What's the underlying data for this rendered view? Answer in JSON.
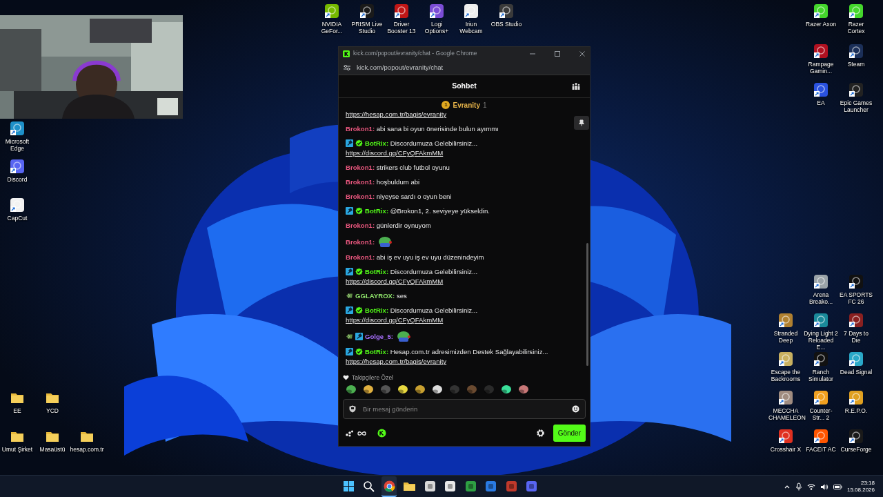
{
  "desktop_icons": [
    {
      "label": "Microsoft Edge",
      "kind": "app",
      "color": "#1e90c8"
    },
    {
      "label": "Discord",
      "kind": "app",
      "color": "#5865f2"
    },
    {
      "label": "CapCut",
      "kind": "app",
      "color": "#f2f2f2"
    },
    {
      "label": "NVIDIA GeFor...",
      "kind": "app",
      "color": "#76b900"
    },
    {
      "label": "PRISM Live Studio",
      "kind": "app",
      "color": "#1a1a1a"
    },
    {
      "label": "Driver Booster 13",
      "kind": "app",
      "color": "#c01616"
    },
    {
      "label": "Logi Options+",
      "kind": "app",
      "color": "#7b4dd6"
    },
    {
      "label": "Iriun Webcam",
      "kind": "app",
      "color": "#eeeeee"
    },
    {
      "label": "OBS Studio",
      "kind": "app",
      "color": "#3a3a3a"
    },
    {
      "label": "Razer Axon",
      "kind": "app",
      "color": "#44d62c"
    },
    {
      "label": "Razer Cortex",
      "kind": "app",
      "color": "#44d62c"
    },
    {
      "label": "Rampage Gamin...",
      "kind": "app",
      "color": "#b01020"
    },
    {
      "label": "Steam",
      "kind": "app",
      "color": "#1b2f58"
    },
    {
      "label": "EA",
      "kind": "app",
      "color": "#2a52e0"
    },
    {
      "label": "Epic Games Launcher",
      "kind": "app",
      "color": "#222222"
    },
    {
      "label": "Arena Breako...",
      "kind": "app",
      "color": "#9aa3a8"
    },
    {
      "label": "EA SPORTS FC 26",
      "kind": "app",
      "color": "#111111"
    },
    {
      "label": "Stranded Deep",
      "kind": "app",
      "color": "#b08030"
    },
    {
      "label": "Dying Light 2 Reloaded E...",
      "kind": "app",
      "color": "#1a8a9a"
    },
    {
      "label": "7 Days to Die",
      "kind": "app",
      "color": "#8a2020"
    },
    {
      "label": "Escape the Backrooms",
      "kind": "app",
      "color": "#c8b060"
    },
    {
      "label": "Ranch Simulator",
      "kind": "app",
      "color": "#111111"
    },
    {
      "label": "Dead Signal",
      "kind": "app",
      "color": "#2aa8c8"
    },
    {
      "label": "MECCHA CHAMELEON",
      "kind": "app",
      "color": "#a08c80"
    },
    {
      "label": "Counter-Str... 2",
      "kind": "app",
      "color": "#f0a020"
    },
    {
      "label": "R.E.P.O.",
      "kind": "app",
      "color": "#e0a020"
    },
    {
      "label": "Crosshair X",
      "kind": "app",
      "color": "#e03020"
    },
    {
      "label": "FACEIT AC",
      "kind": "app",
      "color": "#ff5500"
    },
    {
      "label": "CurseForge",
      "kind": "app",
      "color": "#1a1a1a"
    },
    {
      "label": "EE",
      "kind": "folder"
    },
    {
      "label": "YCD",
      "kind": "folder"
    },
    {
      "label": "Umut Şirket",
      "kind": "folder"
    },
    {
      "label": "Masaüstü",
      "kind": "folder"
    },
    {
      "label": "hesap.com.tr",
      "kind": "folder"
    }
  ],
  "chat_window": {
    "title": "kick.com/popout/evranity/chat - Google Chrome",
    "address": "kick.com/popout/evranity/chat",
    "header": "Sohbet",
    "pinned": {
      "rank": "1",
      "user": "Evranity",
      "count": "1"
    },
    "messages": [
      {
        "kind": "link",
        "link": "https://hesap.com.tr/bagis/evranity"
      },
      {
        "kind": "text",
        "user": "Brokon1:",
        "color": "#e9577e",
        "text": "abi sana bi oyun önerisinde bulun ayımmı"
      },
      {
        "kind": "text",
        "user": "BotRix:",
        "color": "#53fc18",
        "moderator": true,
        "verified": true,
        "text": "Discordumuza Gelebilirsiniz...",
        "link": "https://discord.gg/CFyQFAkmMM"
      },
      {
        "kind": "text",
        "user": "Brokon1:",
        "color": "#e9577e",
        "text": "strikers club futbol oyunu"
      },
      {
        "kind": "text",
        "user": "Brokon1:",
        "color": "#e9577e",
        "text": "hoşbuldum abi"
      },
      {
        "kind": "text",
        "user": "Brokon1:",
        "color": "#e9577e",
        "text": "niyeyse sardı o oyun beni"
      },
      {
        "kind": "text",
        "user": "BotRix:",
        "color": "#53fc18",
        "moderator": true,
        "verified": true,
        "text": "@Brokon1, 2. seviyeye yükseldin."
      },
      {
        "kind": "text",
        "user": "Brokon1:",
        "color": "#e9577e",
        "text": "günlerdir oynuyom"
      },
      {
        "kind": "emote",
        "user": "Brokon1:",
        "color": "#e9577e"
      },
      {
        "kind": "text",
        "user": "Brokon1:",
        "color": "#e9577e",
        "text": "abi iş ev uyu iş ev uyu düzenindeyim"
      },
      {
        "kind": "text",
        "user": "BotRix:",
        "color": "#53fc18",
        "moderator": true,
        "verified": true,
        "text": "Discordumuza Gelebilirsiniz...",
        "link": "https://discord.gg/CFyQFAkmMM"
      },
      {
        "kind": "text",
        "user": "GGLAYROX:",
        "color": "#8fe36b",
        "subscriber": true,
        "text": "ses"
      },
      {
        "kind": "text",
        "user": "BotRix:",
        "color": "#53fc18",
        "moderator": true,
        "verified": true,
        "text": "Discordumuza Gelebilirsiniz...",
        "link": "https://discord.gg/CFyQFAkmMM"
      },
      {
        "kind": "emote",
        "user": "Golge_5:",
        "color": "#a970ff",
        "subscriber": true,
        "moderator": true
      },
      {
        "kind": "text",
        "user": "BotRix:",
        "color": "#53fc18",
        "moderator": true,
        "verified": true,
        "text": "Hesap.com.tr adresimizden Destek Sağlayabilirsiniz...",
        "link": "https://hesap.com.tr/bagis/evranity"
      }
    ],
    "emote_set_label": "Takipçilere Özel",
    "input": {
      "placeholder": "Bir mesaj gönderin"
    },
    "send_button": "Gönder"
  },
  "taskbar": {
    "apps": [
      {
        "kind": "start",
        "selected": false
      },
      {
        "kind": "search",
        "selected": false
      },
      {
        "kind": "browser",
        "selected": true
      },
      {
        "kind": "folder",
        "selected": false
      },
      {
        "kind": "app",
        "color": "#d8d8d8",
        "selected": false
      },
      {
        "kind": "app",
        "color": "#e8e8e8",
        "selected": false
      },
      {
        "kind": "app",
        "color": "#2ea043",
        "selected": false
      },
      {
        "kind": "app",
        "color": "#2a7ae2",
        "selected": false
      },
      {
        "kind": "app",
        "color": "#c0392b",
        "selected": false
      },
      {
        "kind": "app",
        "color": "#5865f2",
        "selected": false
      }
    ],
    "time": "23:18",
    "date": "15.08.2026"
  }
}
